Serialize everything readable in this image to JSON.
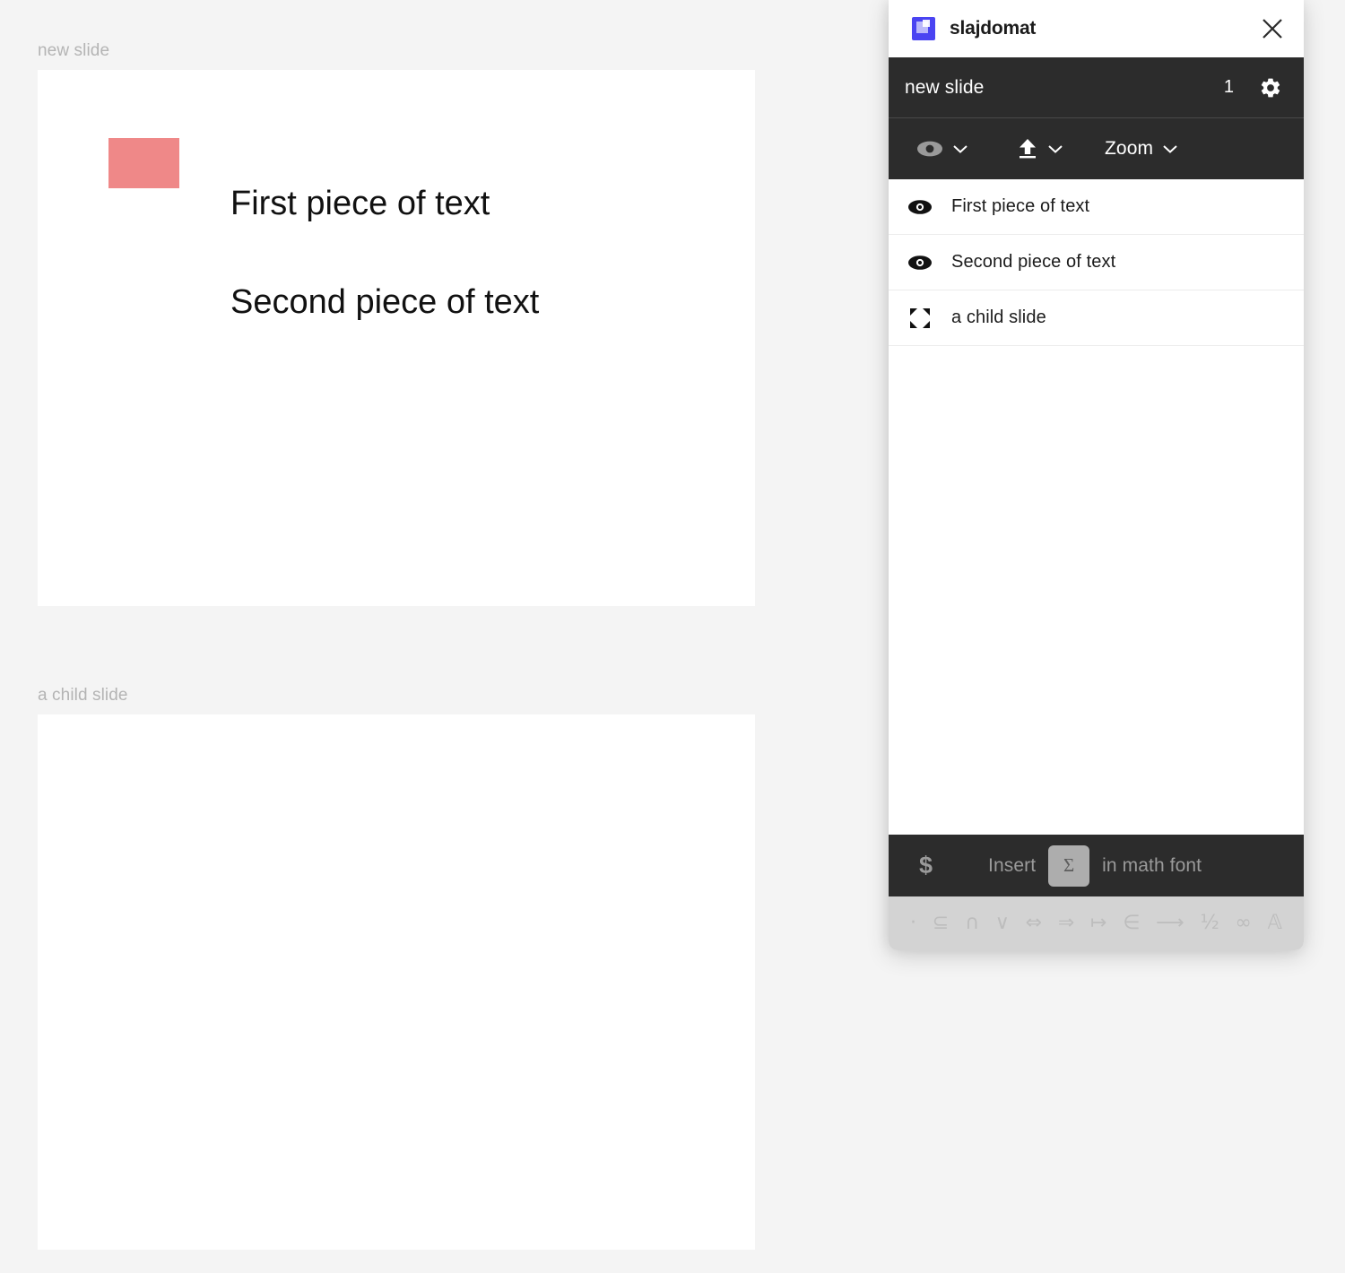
{
  "canvas": {
    "background_color": "#f4f4f4",
    "slides": [
      {
        "caption": "new slide",
        "shape": {
          "icon": "rectangle-shape",
          "color": "#ef8888"
        },
        "texts": [
          "First piece of text",
          "Second piece of text"
        ]
      },
      {
        "caption": "a child slide",
        "texts": []
      }
    ]
  },
  "panel": {
    "titlebar": {
      "app_name": "slajdomat",
      "app_icon": "slajdomat-logo-icon",
      "close_icon": "close-icon"
    },
    "header": {
      "slide_name": "new slide",
      "count": "1",
      "settings_icon": "gear-icon"
    },
    "toolbar": {
      "visibility": {
        "icon": "eye-icon",
        "caret": "chevron-down-icon"
      },
      "upload": {
        "icon": "upload-icon",
        "caret": "chevron-down-icon"
      },
      "zoom": {
        "label": "Zoom",
        "caret": "chevron-down-icon"
      }
    },
    "items": [
      {
        "icon": "eye-icon",
        "label": "First piece of text"
      },
      {
        "icon": "eye-icon",
        "label": "Second piece of text"
      },
      {
        "icon": "expand-icon",
        "label": "a child slide"
      }
    ],
    "math_bar": {
      "dollar": "$",
      "insert_label": "Insert",
      "sigma": "Σ",
      "suffix_label": "in math font"
    },
    "symbols": [
      "·",
      "⊆",
      "∩",
      "∨",
      "⇔",
      "⇒",
      "↦",
      "∈",
      "⟶",
      "½",
      "∞",
      "𝔸"
    ]
  },
  "colors": {
    "panel_dark": "#2c2c2c",
    "accent_blue": "#4a44f2",
    "shape_pink": "#ef8888",
    "symbol_bar": "#d3d3d3"
  }
}
